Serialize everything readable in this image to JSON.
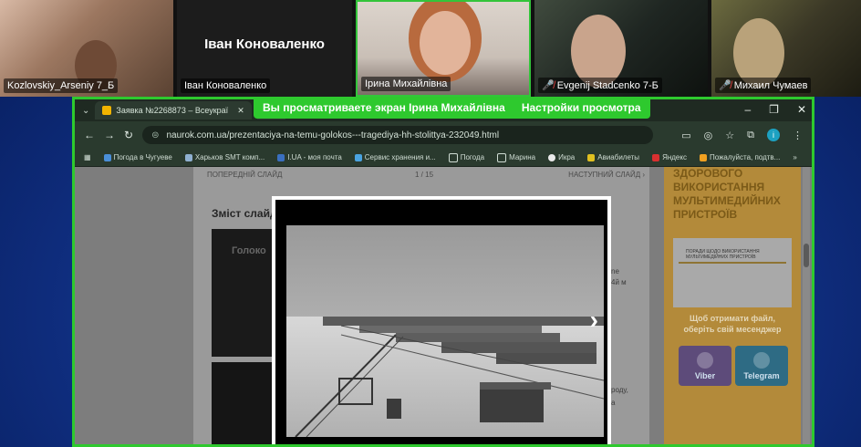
{
  "participants": [
    {
      "name": "Kozlovskiy_Arseniy 7_Б",
      "muted": false
    },
    {
      "name": "Іван Коноваленко",
      "display_name": "Іван Коноваленко",
      "muted": false
    },
    {
      "name": "Ірина Михайлівна",
      "muted": false,
      "active": true
    },
    {
      "name": "Evgenij Stadcenko 7-Б",
      "muted": true
    },
    {
      "name": "Михаил Чумаев",
      "muted": true
    }
  ],
  "share_banner": {
    "text": "Вы просматриваете экран",
    "presenter": "Ірина Михайлівна",
    "settings_label": "Настройки просмотра"
  },
  "browser": {
    "tabs": [
      {
        "title": "Заявка №2268873 – Всеукраї",
        "active": true
      },
      {
        "title": "",
        "active": false
      }
    ],
    "url": "naurok.com.ua/prezentaciya-na-temu-golokos---tragediya-hh-stolittya-232049.html",
    "profile_letter": "i",
    "bookmarks": [
      "Погода в Чугуеве",
      "Харьков SMT комп...",
      "I.UA - моя почта",
      "Сервис хранения и...",
      "Погода",
      "Марина",
      "Икра",
      "Авиабилеты",
      "Яндекс",
      "Пожалуйста, подтв..."
    ]
  },
  "page": {
    "prev_slide": "ПОПЕРЕДНІЙ СЛАЙД",
    "slide_counter": "1 / 15",
    "next_slide": "НАСТУПНИЙ СЛАЙД ›",
    "content_title": "Зміст слайд",
    "thumb_text": "Голоко",
    "frag1": "ne",
    "frag2": "4й м",
    "frag3": "роду,",
    "frag4": "а",
    "sidebar_title": "ЗДОРОВОГО ВИКОРИСТАННЯ МУЛЬТИМЕДИЙНИХ ПРИСТРОЇВ",
    "card_header": "ПОРАДИ ЩОДО ВИКОРИСТАННЯ МУЛЬТИМЕДІЙНИХ ПРИСТРОЇВ",
    "promo": "Щоб отримати файл, оберіть свій месенджер",
    "viber": "Viber",
    "telegram": "Telegram"
  },
  "lightbox": {
    "next_icon": "chevron-right-icon"
  },
  "colors": {
    "share_green": "#2ec92e",
    "muted_red": "#ff4b4b",
    "meeting_blue": "#12348c"
  }
}
